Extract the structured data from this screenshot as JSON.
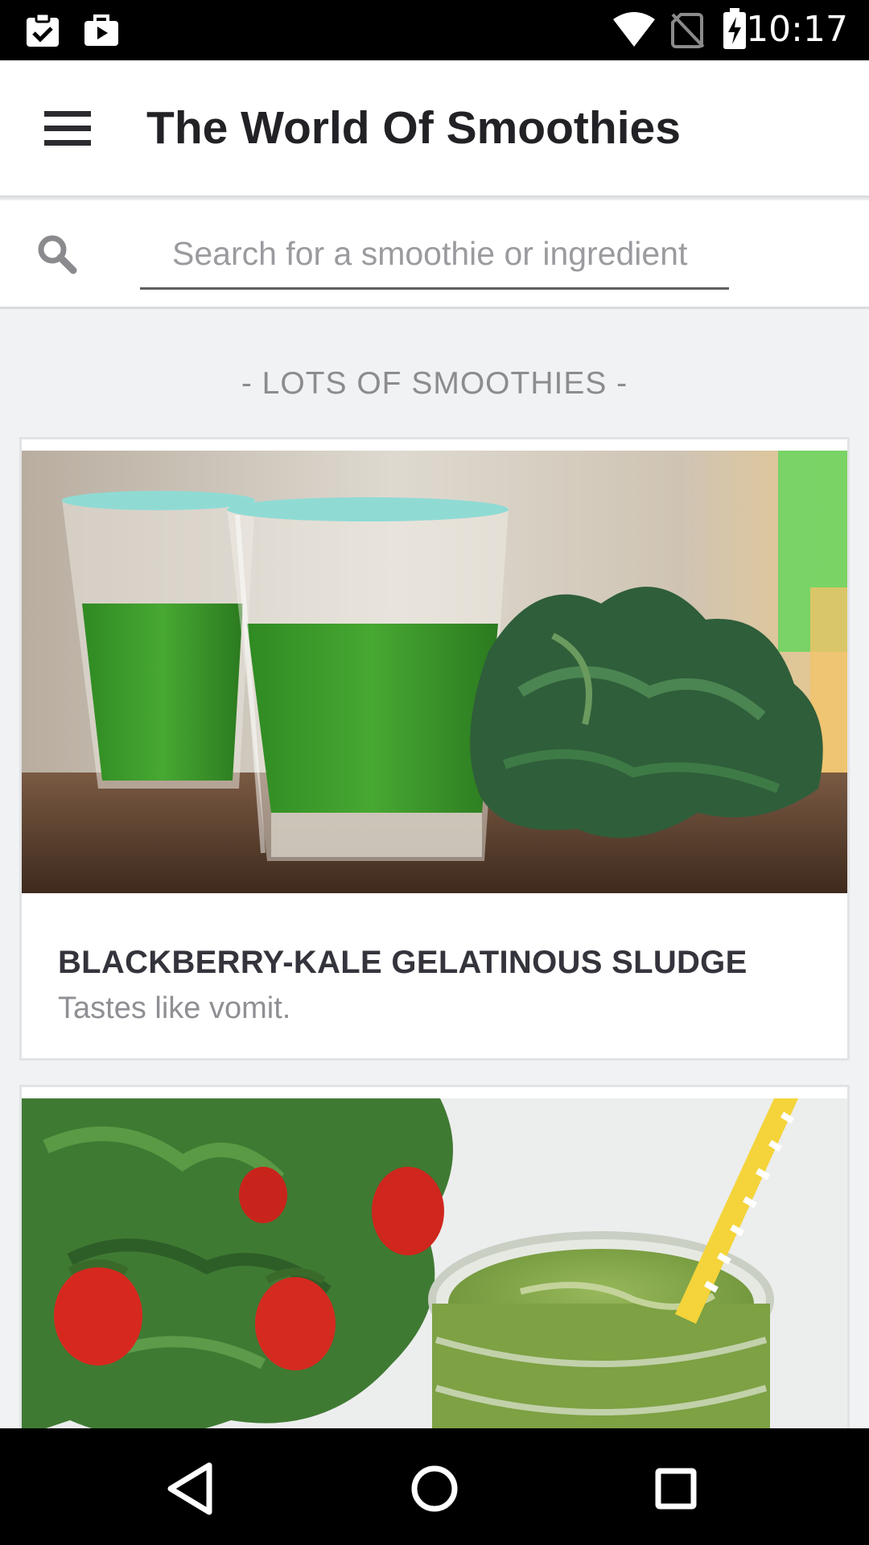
{
  "status_bar": {
    "time": "10:17",
    "icons": [
      "clipboard-check-icon",
      "briefcase-play-icon",
      "wifi-icon",
      "no-sim-icon",
      "battery-charging-icon"
    ]
  },
  "app_bar": {
    "title": "The World Of Smoothies",
    "menu_icon": "hamburger-menu-icon"
  },
  "search": {
    "placeholder": "Search for a smoothie or ingredient",
    "value": "",
    "icon": "search-icon"
  },
  "section": {
    "heading": "- LOTS OF SMOOTHIES -"
  },
  "cards": [
    {
      "title": "BLACKBERRY-KALE GELATINOUS SLUDGE",
      "description": "Tastes like vomit.",
      "image": "green-smoothie-glasses-with-kale-photo"
    },
    {
      "title": "",
      "description": "",
      "image": "green-smoothie-jar-with-strawberries-photo"
    }
  ],
  "nav_bar": {
    "icons": [
      "back-icon",
      "home-icon",
      "recents-icon"
    ]
  },
  "colors": {
    "app_bar_bg": "#ffffff",
    "page_bg": "#f1f2f4",
    "title_text": "#222226",
    "muted_text": "#8c8c90",
    "smoothie_green": "#3f9a2a",
    "glass_rim": "#7fd6cf",
    "straw_yellow": "#e8c52a"
  }
}
